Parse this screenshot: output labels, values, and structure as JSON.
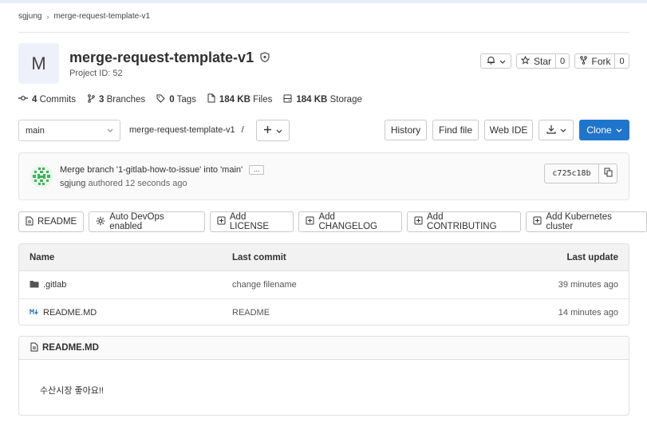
{
  "breadcrumb": {
    "group": "sgjung",
    "project": "merge-request-template-v1"
  },
  "project": {
    "avatar_letter": "M",
    "title": "merge-request-template-v1",
    "id_label": "Project ID: 52"
  },
  "actions": {
    "star_label": "Star",
    "star_count": "0",
    "fork_label": "Fork",
    "fork_count": "0"
  },
  "stats": {
    "commits_count": "4",
    "commits_label": "Commits",
    "branches_count": "3",
    "branches_label": "Branches",
    "tags_count": "0",
    "tags_label": "Tags",
    "files_size": "184 KB",
    "files_label": "Files",
    "storage_size": "184 KB",
    "storage_label": "Storage"
  },
  "repo_nav": {
    "branch": "main",
    "path": "merge-request-template-v1",
    "path_sep": "/",
    "history": "History",
    "find_file": "Find file",
    "web_ide": "Web IDE",
    "clone": "Clone"
  },
  "commit": {
    "message": "Merge branch '1-gitlab-how-to-issue' into 'main'",
    "author": "sgjung",
    "authored_text": "authored 12 seconds ago",
    "sha": "c725c18b",
    "ellipsis": "..."
  },
  "quick_buttons": [
    "README",
    "Auto DevOps enabled",
    "Add LICENSE",
    "Add CHANGELOG",
    "Add CONTRIBUTING",
    "Add Kubernetes cluster"
  ],
  "table": {
    "headers": {
      "name": "Name",
      "last_commit": "Last commit",
      "last_update": "Last update"
    },
    "rows": [
      {
        "name": ".gitlab",
        "commit": "change filename",
        "updated": "39 minutes ago"
      },
      {
        "name": "README.MD",
        "commit": "README",
        "updated": "14 minutes ago"
      }
    ]
  },
  "readme": {
    "title": "README.MD",
    "content": "수산시장 좋아요!!"
  },
  "colors": {
    "clone_bg": "#1f75cb",
    "clone_text": "#ffffff",
    "avatar_bg": "#eef1fa"
  }
}
